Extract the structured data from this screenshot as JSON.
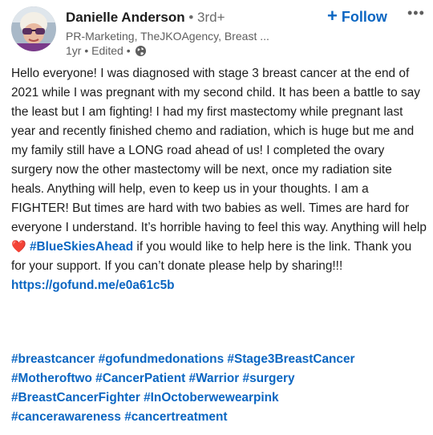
{
  "author": {
    "name": "Danielle Anderson",
    "degree": " • 3rd+",
    "headline": "PR-Marketing, TheJKOAgency, Breast ...",
    "time": "1yr • Edited • "
  },
  "actions": {
    "follow_plus": "+",
    "follow_label": "Follow",
    "more_label": "•••"
  },
  "post": {
    "text_part1": "Hello everyone! I was diagnosed with stage 3 breast cancer at the end of 2021 while I was pregnant with my second child. It has been a battle to say the least but I am fighting! I had my first mastectomy while pregnant last year and recently finished chemo and radiation, which is huge but me and my family still have a LONG road ahead of us! I completed the ovary surgery now the other mastectomy will be next, once my radiation site heals. Anything will help, even to keep us in your thoughts. I am a FIGHTER! But times are hard with two babies as well. Times are hard for everyone I understand. It’s horrible having to feel this way. Anything will help ",
    "heart": "❤️",
    "inline_hashtag": "#BlueSkiesAhead",
    "text_part2": " if you would like to help here is the link. Thank you for your support. If you can’t donate please help by sharing!!!",
    "link": "https://gofund.me/e0a61c5b"
  },
  "hashtags": [
    "#breastcancer",
    "#gofundmedonations",
    "#Stage3BreastCancer",
    "#Motheroftwo",
    "#CancerPatient",
    "#Warrior",
    "#surgery",
    "#BreastCancerFighter",
    "#InOctoberwewearpink",
    "#cancerawareness",
    "#cancertreatment"
  ],
  "colors": {
    "accent": "#0a66c2",
    "text": "#1d1d1d",
    "secondary": "#5e5e5e"
  },
  "icons": {
    "avatar": "avatar",
    "globe": "globe-icon",
    "more": "more-options-icon"
  }
}
